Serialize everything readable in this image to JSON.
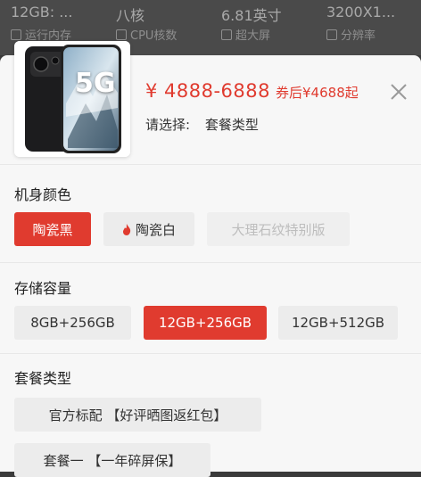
{
  "spec_strip": {
    "values": [
      "12GB: ...",
      "八核",
      "6.81英寸",
      "3200X1..."
    ],
    "labels": [
      "运行内存",
      "CPU核数",
      "超大屏",
      "分辨率"
    ]
  },
  "product": {
    "image_text": "5G",
    "price": "¥ 4888-6888",
    "coupon_price": "券后¥4688起",
    "select_prompt": "请选择:",
    "select_value": "套餐类型"
  },
  "color_section": {
    "title": "机身颜色",
    "options": [
      {
        "label": "陶瓷黑",
        "state": "selected"
      },
      {
        "label": "陶瓷白",
        "state": "normal",
        "icon": "flame-icon"
      },
      {
        "label": "大理石纹特别版",
        "state": "disabled"
      }
    ]
  },
  "storage_section": {
    "title": "存储容量",
    "options": [
      {
        "label": "8GB+256GB",
        "state": "normal"
      },
      {
        "label": "12GB+256GB",
        "state": "selected"
      },
      {
        "label": "12GB+512GB",
        "state": "normal"
      }
    ]
  },
  "package_section": {
    "title": "套餐类型",
    "options": [
      {
        "label": "官方标配 【好评晒图返红包】",
        "state": "normal"
      },
      {
        "label": "套餐一 【一年碎屏保】",
        "state": "normal"
      }
    ]
  },
  "colors": {
    "accent": "#e03b2f",
    "option_bg": "#ececec",
    "sheet_bg": "#f7f7f7"
  }
}
